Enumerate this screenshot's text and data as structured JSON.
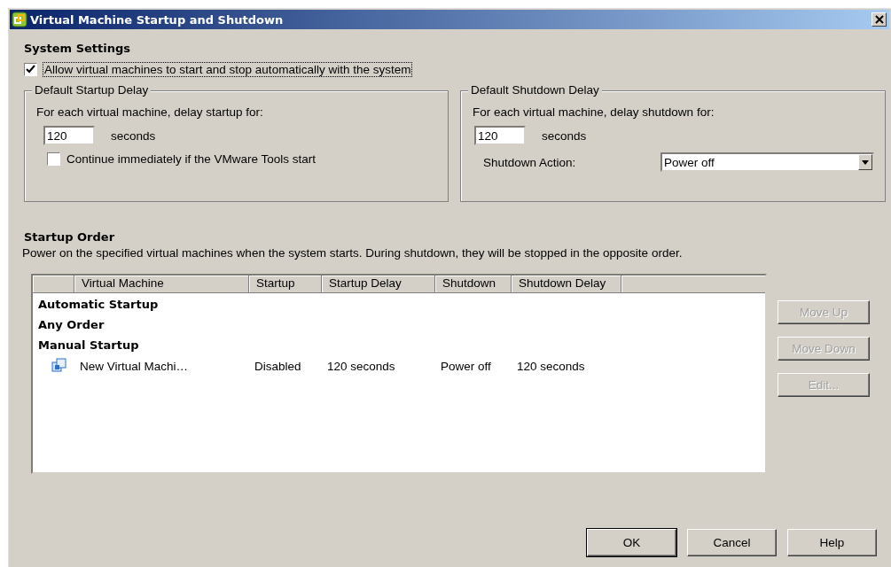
{
  "window": {
    "title": "Virtual Machine Startup and Shutdown"
  },
  "system_settings": {
    "heading": "System Settings",
    "auto_start": {
      "label": "Allow virtual machines to start and stop automatically with the system",
      "checked": true
    }
  },
  "startup_delay": {
    "legend": "Default Startup Delay",
    "prompt": "For each virtual machine, delay startup for:",
    "value": "120",
    "unit": "seconds",
    "continue_option": {
      "label": "Continue immediately if the VMware Tools start",
      "checked": false
    }
  },
  "shutdown_delay": {
    "legend": "Default Shutdown Delay",
    "prompt": "For each virtual machine, delay shutdown for:",
    "value": "120",
    "unit": "seconds",
    "action_label": "Shutdown Action:",
    "action_value": "Power off"
  },
  "startup_order": {
    "heading": "Startup Order",
    "description": "Power on the specified virtual machines when the system starts. During shutdown, they will be stopped in the opposite order.",
    "table": {
      "columns": [
        "Virtual Machine",
        "Startup",
        "Startup Delay",
        "Shutdown",
        "Shutdown Delay"
      ],
      "groups": [
        {
          "name": "Automatic Startup"
        },
        {
          "name": "Any Order"
        },
        {
          "name": "Manual Startup",
          "rows": [
            {
              "cells": [
                "New Virtual Machi…",
                "Disabled",
                "120 seconds",
                "Power off",
                "120 seconds"
              ]
            }
          ]
        }
      ]
    },
    "side_buttons": [
      {
        "label": "Move Up",
        "disabled": true
      },
      {
        "label": "Move Down",
        "disabled": true
      },
      {
        "label": "Edit...",
        "disabled": true
      }
    ]
  },
  "footer_buttons": [
    {
      "label": "OK",
      "default": true
    },
    {
      "label": "Cancel",
      "default": false
    },
    {
      "label": "Help",
      "default": false
    }
  ]
}
